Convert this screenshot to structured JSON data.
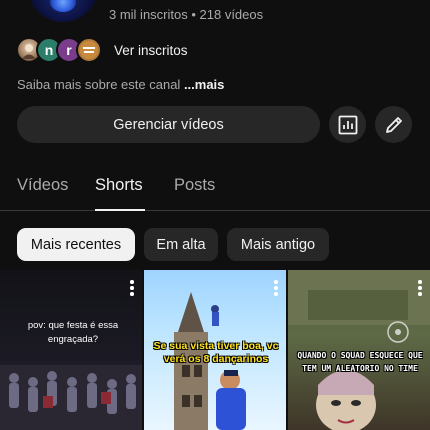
{
  "channel": {
    "stats": "3 mil inscritos • 218 vídeos",
    "subscribers_avatars": [
      {
        "initial": "",
        "color": "#9c7a5a"
      },
      {
        "initial": "n",
        "color": "#2c7d69"
      },
      {
        "initial": "r",
        "color": "#7a3d8c"
      },
      {
        "initial": "",
        "color": "#b07a3a"
      }
    ],
    "view_subscribers_label": "Ver inscritos",
    "about_text": "Saiba mais sobre este canal ",
    "about_more": "...mais"
  },
  "actions": {
    "manage_videos_label": "Gerenciar vídeos",
    "stats_icon": "bar-chart-icon",
    "edit_icon": "pencil-icon"
  },
  "tabs": [
    {
      "label": "Vídeos",
      "active": false
    },
    {
      "label": "Shorts",
      "active": true
    },
    {
      "label": "Posts",
      "active": false
    }
  ],
  "filters": [
    {
      "label": "Mais recentes",
      "selected": true
    },
    {
      "label": "Em alta",
      "selected": false
    },
    {
      "label": "Mais antigo",
      "selected": false
    }
  ],
  "shorts": [
    {
      "caption": "pov: que festa é essa engraçada?"
    },
    {
      "caption": "Se sua vista tiver boa, vc verá os 8 dançarinos"
    },
    {
      "caption": "QUANDO O SQUAD ESQUECE QUE TEM UM ALEATORIO NO TIME"
    }
  ]
}
